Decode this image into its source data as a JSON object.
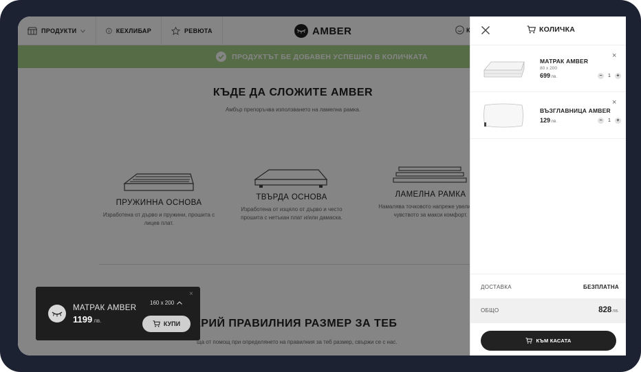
{
  "header": {
    "nav": [
      {
        "label": "ПРОДУКТИ"
      },
      {
        "label": "КЕХЛИБАР"
      },
      {
        "label": "РЕВЮТА"
      }
    ],
    "logo_text": "AMBER",
    "partial_right_text": "К"
  },
  "banner": {
    "message": "ПРОДУКТЪТ БЕ ДОБАВЕН УСПЕШНО В КОЛИЧКАТА"
  },
  "section_bases": {
    "title": "КЪДЕ ДА СЛОЖИТЕ AMBER",
    "subtitle": "Амбър препоръчва използването на ламелна рамка.",
    "bases": [
      {
        "title": "ПРУЖИННА ОСНОВА",
        "desc": "Изработена от дърво и пружини, прошита с лицев плат."
      },
      {
        "title": "ТВЪРДА ОСНОВА",
        "desc": "Изработена от изцяло от дърво и често прошита с нетъкан плат и/или дамаска."
      },
      {
        "title": "ЛАМЕЛНА РАМКА",
        "desc": "Намалява точковото напреже увеличава чувството за макси комфорт."
      }
    ]
  },
  "section_size": {
    "title": "КРИЙ ПРАВИЛНИЯ РАЗМЕР ЗА ТЕБ",
    "subtitle": "ща от помощ при определянето на правилния за теб размер, свържи се с нас."
  },
  "float_bar": {
    "name": "МАТРАК AMBER",
    "price": "1199",
    "currency": "лв.",
    "size": "160 x 200",
    "buy_label": "КУПИ",
    "close": "×"
  },
  "cart": {
    "title": "КОЛИЧКА",
    "items": [
      {
        "name": "МАТРАК AMBER",
        "size": "80 x 200",
        "price": "699",
        "currency": "лв.",
        "qty": "1"
      },
      {
        "name": "ВЪЗГЛАВНИЦА AMBER",
        "price": "129",
        "currency": "лв.",
        "qty": "1"
      }
    ],
    "shipping_label": "ДОСТАВКА",
    "shipping_value": "БЕЗПЛАТНА",
    "total_label": "ОБЩО",
    "total_value": "828",
    "total_currency": "лв.",
    "checkout_label": "КЪМ КАСАТА",
    "minus": "−",
    "plus": "+",
    "remove": "×"
  },
  "colors": {
    "banner": "#a6cf86",
    "frame": "#1d2233",
    "dark": "#1e1e1e"
  }
}
